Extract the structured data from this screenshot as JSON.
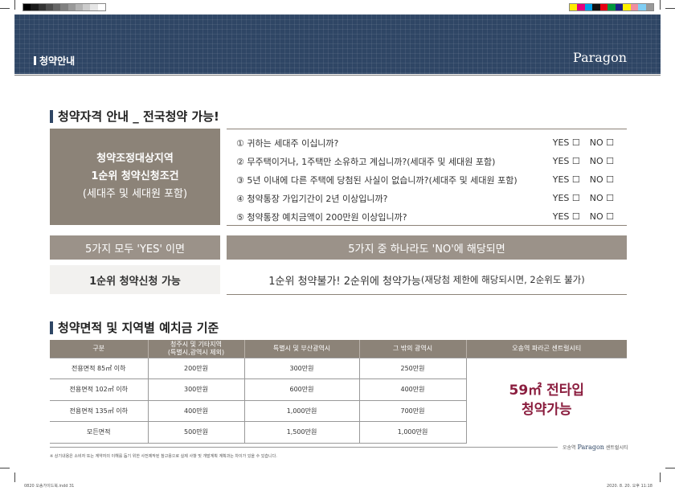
{
  "header": {
    "section_label": "청약안내",
    "brand": "Paragon"
  },
  "eligibility": {
    "heading": "청약자격 안내 _ 전국청약 가능!",
    "condition_box": {
      "line1": "청약조정대상지역",
      "line2": "1순위 청약신청조건",
      "line3": "(세대주 및 세대원 포함)"
    },
    "questions": [
      {
        "text": "① 귀하는 세대주 이십니까?",
        "yes": "YES ☐",
        "no": "NO ☐"
      },
      {
        "text": "② 무주택이거나, 1주택만 소유하고 계십니까?(세대주 및 세대원 포함)",
        "yes": "YES ☐",
        "no": "NO ☐"
      },
      {
        "text": "③ 5년 이내에 다른 주택에 당첨된 사실이 없습니까?(세대주 및 세대원 포함)",
        "yes": "YES ☐",
        "no": "NO ☐"
      },
      {
        "text": "④ 청약통장 가입기간이 2년 이상입니까?",
        "yes": "YES ☐",
        "no": "NO ☐"
      },
      {
        "text": "⑤ 청약통장 예치금액이 200만원 이상입니까?",
        "yes": "YES ☐",
        "no": "NO ☐"
      }
    ],
    "all_yes": {
      "label": "5가지 모두 'YES' 이면",
      "result": "1순위 청약신청 가능"
    },
    "any_no": {
      "label": "5가지 중 하나라도 'NO'에 해당되면",
      "result_main": "1순위 청약불가!  2순위에 청약가능",
      "result_note": "(재당첨 제한에 해당되시면, 2순위도 불가)"
    }
  },
  "deposit": {
    "heading": "청약면적 및 지역별 예치금 기준",
    "columns": [
      "구분",
      "청주시 및 기타지역",
      "(특별시,광역시 제외)",
      "특별시 및 부산광역시",
      "그 밖의 광역시",
      "오송역 파라곤 센트럴시티"
    ],
    "rows": [
      [
        "전용면적 85㎡ 이하",
        "200만원",
        "300만원",
        "250만원"
      ],
      [
        "전용면적 102㎡ 이하",
        "300만원",
        "600만원",
        "400만원"
      ],
      [
        "전용면적 135㎡ 이하",
        "400만원",
        "1,000만원",
        "700만원"
      ],
      [
        "모든면적",
        "500만원",
        "1,500만원",
        "1,000만원"
      ]
    ],
    "highlight_line1": "59㎡ 전타입",
    "highlight_line2": "청약가능",
    "footer_logo": {
      "pre": "오송역",
      "brand": "Paragon",
      "post": "센트럴시티"
    }
  },
  "footnote": "※ 상기내용은 소비자 또는 계약자의 이해를 돕기 위한 사전제작된 참고용으로 실제 사항 및 개발계획 계획과는 차이가 있을 수 있습니다.",
  "print_info": {
    "left": "0820 오송가이드북.indd  31",
    "right": "2020. 8. 20.   오후 11:18"
  },
  "colors": {
    "header_navy": "#2f4665",
    "taupe": "#8c8378",
    "highlight": "#8b1e3f"
  }
}
